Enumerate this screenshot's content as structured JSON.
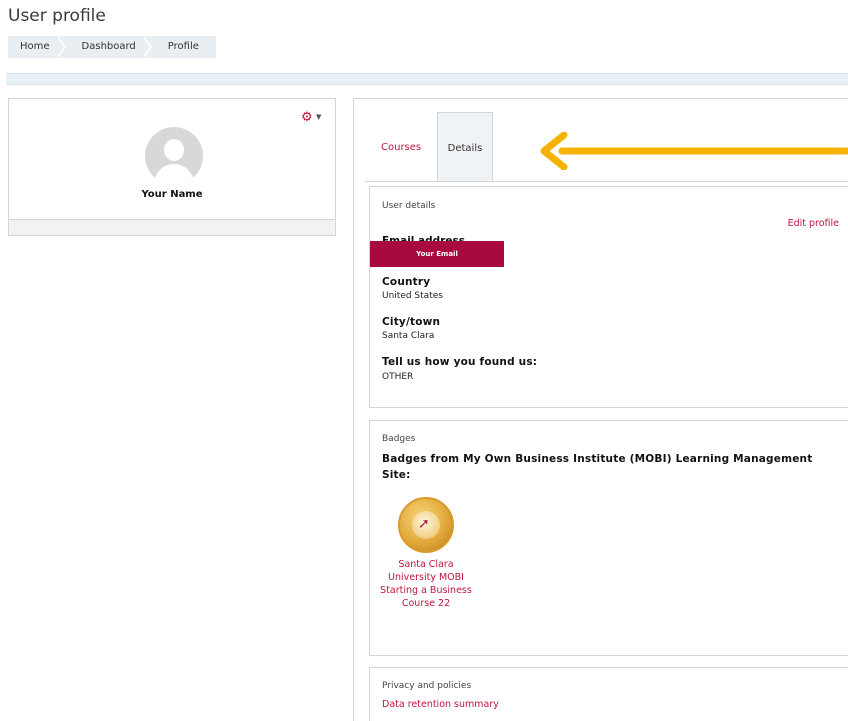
{
  "page": {
    "title": "User profile"
  },
  "breadcrumb": [
    "Home",
    "Dashboard",
    "Profile"
  ],
  "profile": {
    "name": "Your Name"
  },
  "tabs": {
    "courses": "Courses",
    "details": "Details"
  },
  "user_details": {
    "title": "User details",
    "edit_profile": "Edit profile",
    "email_label": "Email address",
    "email_value": "Your Email",
    "country_label": "Country",
    "country_value": "United States",
    "city_label": "City/town",
    "city_value": "Santa Clara",
    "found_label": "Tell us how you found us:",
    "found_value": "OTHER"
  },
  "badges": {
    "title": "Badges",
    "heading": "Badges from My Own Business Institute (MOBI) Learning Management Site:",
    "badge_caption": "Santa Clara University MOBI Starting a Business Course 22"
  },
  "privacy": {
    "title": "Privacy and policies",
    "link": "Data retention summary"
  },
  "colors": {
    "accent": "#c0163f",
    "email_box": "#a8093f",
    "arrow": "#f5b300"
  }
}
